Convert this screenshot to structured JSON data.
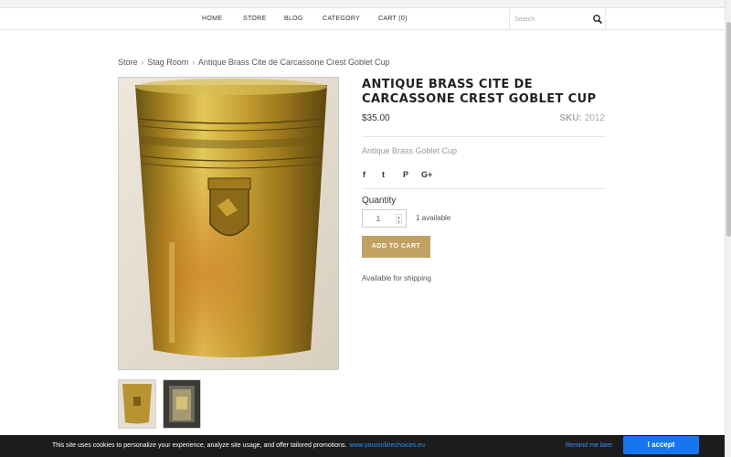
{
  "nav": {
    "items": [
      "HOME",
      "STORE",
      "BLOG",
      "CATEGORY",
      "CART (0)"
    ],
    "search_placeholder": "Search"
  },
  "breadcrumb": {
    "items": [
      "Store",
      "Stag Room",
      "Antique Brass Cite de Carcassone Crest Goblet Cup"
    ]
  },
  "product": {
    "title": "ANTIQUE BRASS CITE DE CARCASSONE CREST GOBLET CUP",
    "price": "$35.00",
    "sku_label": "SKU:",
    "sku_value": "2012",
    "description": "Antique Brass Goblet Cup",
    "quantity_label": "Quantity",
    "quantity_value": "1",
    "available": "1 available",
    "add_to_cart": "ADD TO CART",
    "shipping": "Available for shipping"
  },
  "social": {
    "icons": [
      "facebook-icon",
      "twitter-icon",
      "pinterest-icon",
      "google-plus-icon"
    ],
    "labels": [
      "f",
      "t",
      "P",
      "G+"
    ]
  },
  "cookie": {
    "text": "This site uses cookies to personalize your experience, analyze site usage, and offer tailored promotions.",
    "link": "www.youronlinechoices.eu",
    "remind": "Remind me later",
    "accept": "I accept"
  },
  "colors": {
    "accent": "#c1a163",
    "cookie_bg": "#1c1c1c",
    "accept_bg": "#1875f0"
  }
}
